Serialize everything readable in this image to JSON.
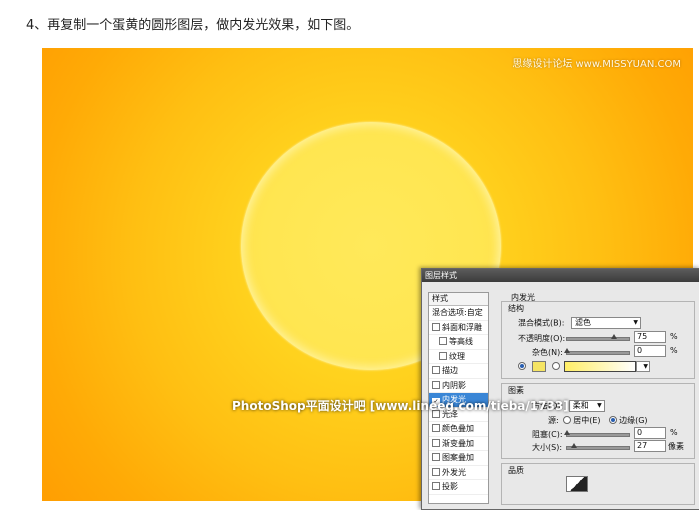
{
  "article": {
    "step_text": "4、再复制一个蛋黄的圆形图层，做内发光效果，如下图。"
  },
  "canvas": {
    "watermark_top": "思缘设计论坛 www.MISSYUAN.COM",
    "watermark_bottom": "PhotoShop平面设计吧 [www.lineeg.com/tieba/1733]"
  },
  "dialog": {
    "title": "图层样式",
    "styles_header": "样式",
    "styles": [
      {
        "label": "混合选项:自定",
        "checkbox": false,
        "checked": false,
        "sub": false,
        "selected": false
      },
      {
        "label": "斜面和浮雕",
        "checkbox": true,
        "checked": false,
        "sub": false,
        "selected": false
      },
      {
        "label": "等高线",
        "checkbox": true,
        "checked": false,
        "sub": true,
        "selected": false
      },
      {
        "label": "纹理",
        "checkbox": true,
        "checked": false,
        "sub": true,
        "selected": false
      },
      {
        "label": "描边",
        "checkbox": true,
        "checked": false,
        "sub": false,
        "selected": false
      },
      {
        "label": "内阴影",
        "checkbox": true,
        "checked": false,
        "sub": false,
        "selected": false
      },
      {
        "label": "内发光",
        "checkbox": true,
        "checked": true,
        "sub": false,
        "selected": true
      },
      {
        "label": "光泽",
        "checkbox": true,
        "checked": false,
        "sub": false,
        "selected": false
      },
      {
        "label": "颜色叠加",
        "checkbox": true,
        "checked": false,
        "sub": false,
        "selected": false
      },
      {
        "label": "渐变叠加",
        "checkbox": true,
        "checked": false,
        "sub": false,
        "selected": false
      },
      {
        "label": "图案叠加",
        "checkbox": true,
        "checked": false,
        "sub": false,
        "selected": false
      },
      {
        "label": "外发光",
        "checkbox": true,
        "checked": false,
        "sub": false,
        "selected": false
      },
      {
        "label": "投影",
        "checkbox": true,
        "checked": false,
        "sub": false,
        "selected": false
      }
    ],
    "section_title": "内发光",
    "structure": {
      "legend": "结构",
      "blend_mode_label": "混合模式(B):",
      "blend_mode_value": "滤色",
      "opacity_label": "不透明度(O):",
      "opacity_value": "75",
      "opacity_unit": "%",
      "opacity_fraction": 0.75,
      "noise_label": "杂色(N):",
      "noise_value": "0",
      "noise_unit": "%",
      "noise_fraction": 0.0,
      "glow_color": "#f5e463"
    },
    "elements": {
      "legend": "图素",
      "method_label": "方法(Q):",
      "method_value": "柔和",
      "source_label": "源:",
      "source_center": "居中(E)",
      "source_edge": "边缘(G)",
      "choke_label": "阻塞(C):",
      "choke_value": "0",
      "choke_unit": "%",
      "choke_fraction": 0.0,
      "size_label": "大小(S):",
      "size_value": "27",
      "size_unit": "像素",
      "size_fraction": 0.11
    },
    "quality": {
      "legend": "品质"
    }
  }
}
